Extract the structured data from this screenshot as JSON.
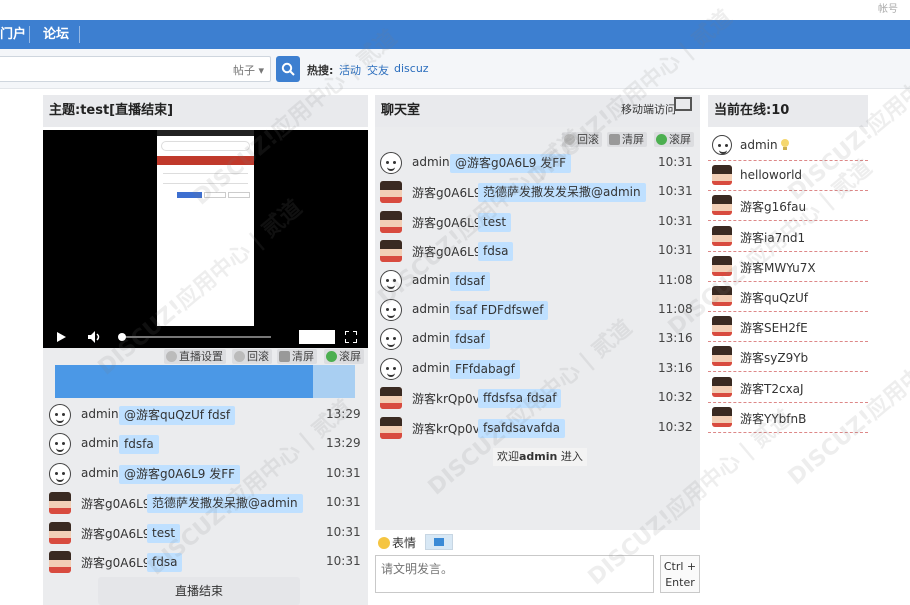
{
  "topbar": {
    "corner_text": "帐号"
  },
  "nav": {
    "items": [
      {
        "label": "门户"
      },
      {
        "label": "论坛"
      }
    ]
  },
  "search": {
    "type_label": "帖子 ▾",
    "hot_label": "热搜:",
    "hot_links": [
      "活动",
      "交友",
      "discuz"
    ]
  },
  "left": {
    "title": "主题:test[直播结束]",
    "tools": [
      "直播设置",
      "回滚",
      "清屏",
      "滚屏"
    ],
    "messages": [
      {
        "user": "admin",
        "avatar": "admin",
        "text": "@游客quQzUf fdsf",
        "time": "13:29"
      },
      {
        "user": "admin",
        "avatar": "admin",
        "text": "fdsfa",
        "time": "13:29"
      },
      {
        "user": "admin",
        "avatar": "admin",
        "text": "@游客g0A6L9 发FF",
        "time": "10:31"
      },
      {
        "user": "游客g0A6L9",
        "avatar": "guest",
        "text": "范德萨发撒发呆撒@admin",
        "time": "10:31"
      },
      {
        "user": "游客g0A6L9",
        "avatar": "guest",
        "text": "test",
        "time": "10:31"
      },
      {
        "user": "游客g0A6L9",
        "avatar": "guest",
        "text": "fdsa",
        "time": "10:31"
      }
    ],
    "end_label": "直播结束"
  },
  "middle": {
    "title": "聊天室",
    "mobile_label": "移动端访问",
    "tools": [
      "回滚",
      "清屏",
      "滚屏"
    ],
    "messages": [
      {
        "user": "admin",
        "avatar": "admin",
        "text": "@游客g0A6L9 发FF",
        "time": "10:31"
      },
      {
        "user": "游客g0A6L9",
        "avatar": "guest",
        "text": "范德萨发撒发发呆撒@admin",
        "time": "10:31"
      },
      {
        "user": "游客g0A6L9",
        "avatar": "guest",
        "text": "test",
        "time": "10:31"
      },
      {
        "user": "游客g0A6L9",
        "avatar": "guest",
        "text": "fdsa",
        "time": "10:31"
      },
      {
        "user": "admin",
        "avatar": "admin",
        "text": "fdsaf",
        "time": "11:08"
      },
      {
        "user": "admin",
        "avatar": "admin",
        "text": "fsaf FDFdfswef",
        "time": "11:08"
      },
      {
        "user": "admin",
        "avatar": "admin",
        "text": "fdsaf",
        "time": "13:16"
      },
      {
        "user": "admin",
        "avatar": "admin",
        "text": "FFfdabagf",
        "time": "13:16"
      },
      {
        "user": "游客krQp0v",
        "avatar": "guest",
        "text": "ffdsfsa fdsaf",
        "time": "10:32"
      },
      {
        "user": "游客krQp0v",
        "avatar": "guest",
        "text": "fsafdsavafda",
        "time": "10:32"
      }
    ],
    "welcome_prefix": "欢迎",
    "welcome_user": "admin",
    "welcome_suffix": " 进入",
    "emoji_label": "表情",
    "input_placeholder": "请文明发言。",
    "send_line1": "Ctrl +",
    "send_line2": "Enter"
  },
  "right": {
    "title": "当前在线:10",
    "users": [
      {
        "name": "admin",
        "avatar": "admin",
        "bulb": true
      },
      {
        "name": "helloworld",
        "avatar": "guest"
      },
      {
        "name": "游客g16fau",
        "avatar": "guest"
      },
      {
        "name": "游客ia7nd1",
        "avatar": "guest"
      },
      {
        "name": "游客MWYu7X",
        "avatar": "guest"
      },
      {
        "name": "游客quQzUf",
        "avatar": "guest"
      },
      {
        "name": "游客SEH2fE",
        "avatar": "guest"
      },
      {
        "name": "游客syZ9Yb",
        "avatar": "guest"
      },
      {
        "name": "游客T2cxaJ",
        "avatar": "guest"
      },
      {
        "name": "游客YYbfnB",
        "avatar": "guest"
      }
    ]
  },
  "watermark_text": "DISCUZ!应用中心 | 贰道",
  "colors": {
    "nav": "#3d7fd0",
    "bubble": "#bfe0ff",
    "panel_bg": "#ebecee",
    "dashed_border": "#dd8888"
  }
}
